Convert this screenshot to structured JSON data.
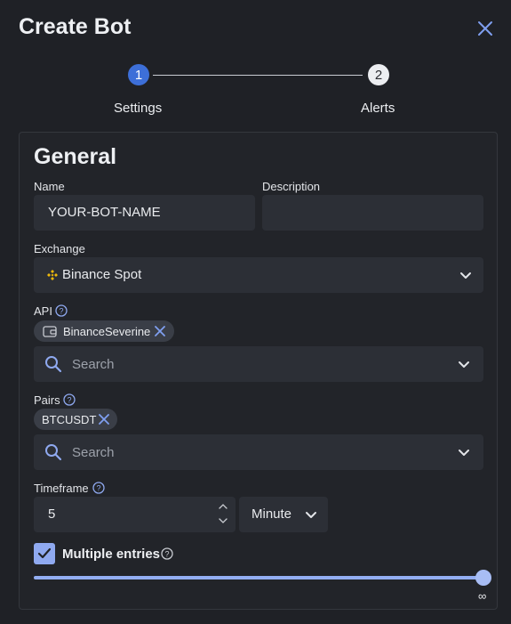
{
  "dialog": {
    "title": "Create Bot"
  },
  "stepper": {
    "steps": [
      {
        "number": "1",
        "label": "Settings"
      },
      {
        "number": "2",
        "label": "Alerts"
      }
    ]
  },
  "general": {
    "heading": "General",
    "name": {
      "label": "Name",
      "value": "YOUR-BOT-NAME"
    },
    "description": {
      "label": "Description",
      "value": ""
    },
    "exchange": {
      "label": "Exchange",
      "value": "Binance Spot"
    },
    "api": {
      "label": "API",
      "chip": "BinanceSeverine",
      "placeholder": "Search"
    },
    "pairs": {
      "label": "Pairs",
      "chip": "BTCUSDT",
      "placeholder": "Search"
    },
    "timeframe": {
      "label": "Timeframe",
      "value": "5",
      "unit": "Minute"
    },
    "multiple_entries": {
      "label": "Multiple entries",
      "checked": true,
      "slider_value": "∞"
    }
  },
  "colors": {
    "accent": "#3d6fd8",
    "slider": "#93aef2",
    "background": "#1f2126",
    "binance": "#f0b90b"
  },
  "icons": [
    "close-icon",
    "help-icon",
    "wallet-icon",
    "search-icon",
    "chevron-down-icon",
    "binance-logo-icon",
    "check-icon"
  ]
}
